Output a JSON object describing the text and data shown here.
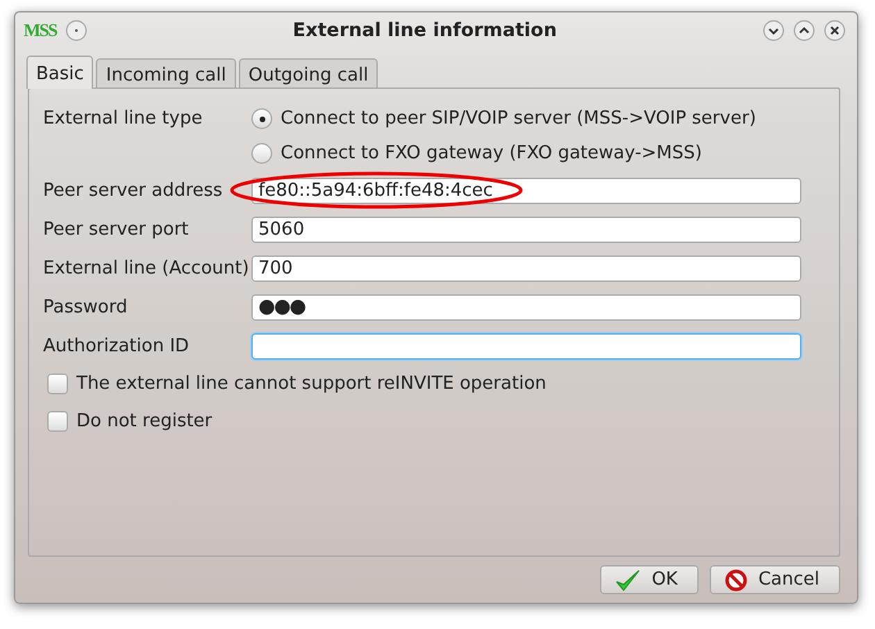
{
  "window": {
    "logo": "MSS",
    "title": "External line information"
  },
  "tabs": [
    {
      "label": "Basic",
      "selected": true
    },
    {
      "label": "Incoming call",
      "selected": false
    },
    {
      "label": "Outgoing call",
      "selected": false
    }
  ],
  "line_type": {
    "label": "External line type",
    "options": [
      {
        "label": "Connect to peer SIP/VOIP server (MSS->VOIP server)",
        "selected": true
      },
      {
        "label": "Connect to FXO gateway (FXO gateway->MSS)",
        "selected": false
      }
    ]
  },
  "fields": [
    {
      "label": "Peer server address",
      "value": "fe80::5a94:6bff:fe48:4cec",
      "focused": false,
      "highlighted": true
    },
    {
      "label": "Peer server port",
      "value": "5060",
      "focused": false,
      "highlighted": false
    },
    {
      "label": "External line (Account)",
      "value": "700",
      "focused": false,
      "highlighted": false
    },
    {
      "label": "Password",
      "value": "●●●",
      "focused": false,
      "highlighted": false
    },
    {
      "label": "Authorization ID",
      "focused": true,
      "highlighted": false
    }
  ],
  "checkboxes": [
    {
      "label": "The external line cannot support reINVITE operation",
      "checked": false
    },
    {
      "label": "Do not register",
      "checked": false
    }
  ],
  "buttons": [
    {
      "kind": "ok",
      "label": "OK"
    },
    {
      "kind": "cancel",
      "label": "Cancel"
    }
  ]
}
